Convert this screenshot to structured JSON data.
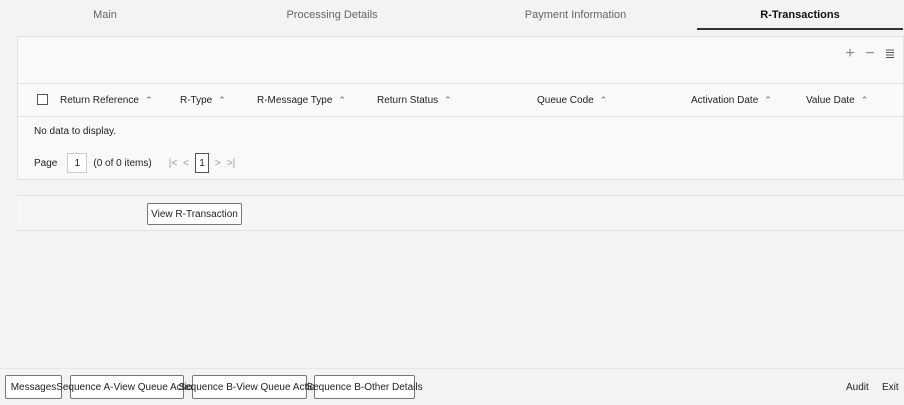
{
  "tabs": [
    {
      "label": "Main"
    },
    {
      "label": "Processing Details"
    },
    {
      "label": "Payment Information"
    },
    {
      "label": "R-Transactions"
    }
  ],
  "grid": {
    "columns": [
      {
        "label": "Return Reference"
      },
      {
        "label": "R-Type"
      },
      {
        "label": "R-Message Type"
      },
      {
        "label": "Return Status"
      },
      {
        "label": "Queue Code"
      },
      {
        "label": "Activation Date"
      },
      {
        "label": "Value Date"
      }
    ],
    "empty_message": "No data to display.",
    "pager": {
      "page_label": "Page",
      "page_value": "1",
      "items_text": "(0 of 0 items)",
      "first": "|<",
      "prev": "<",
      "current": "1",
      "next": ">",
      "last": ">|"
    },
    "toolbar": {
      "add": "+",
      "remove": "−",
      "columns": "≣"
    }
  },
  "view_button": "View R-Transaction",
  "footer": {
    "left_buttons": [
      {
        "label": "Messages"
      },
      {
        "label": "Sequence A-View Queue Action"
      },
      {
        "label": "Sequence B-View Queue Action"
      },
      {
        "label": "Sequence B-Other Details"
      }
    ],
    "audit": "Audit",
    "exit": "Exit"
  },
  "icons": {
    "sort": "sort-icon",
    "checkbox": "select-all-checkbox"
  },
  "colors": {
    "background": "#f3f3f3",
    "active_tab_underline": "#333333"
  }
}
